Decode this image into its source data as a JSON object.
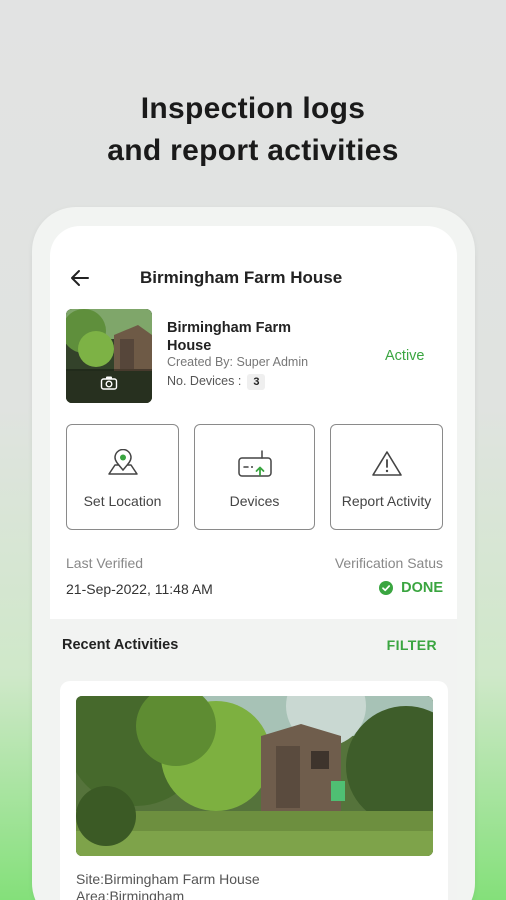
{
  "promo": {
    "headline_line1": "Inspection logs",
    "headline_line2": "and report activities"
  },
  "appbar": {
    "title": "Birmingham Farm House",
    "back_icon": "arrow-left-icon"
  },
  "property": {
    "name": "Birmingham Farm House",
    "created_by": "Created By: Super Admin",
    "devices_label": "No. Devices :",
    "devices_count": "3",
    "status": "Active",
    "thumbnail_icon": "camera-icon"
  },
  "actions": [
    {
      "label": "Set Location",
      "icon": "location-pin-icon"
    },
    {
      "label": "Devices",
      "icon": "router-device-icon"
    },
    {
      "label": "Report Activity",
      "icon": "warning-triangle-icon"
    }
  ],
  "verification": {
    "last_verified_label": "Last Verified",
    "last_verified_value": "21-Sep-2022, 11:48 AM",
    "status_label": "Verification Satus",
    "status_value": "DONE"
  },
  "recent": {
    "title": "Recent Activities",
    "filter_label": "FILTER",
    "items": [
      {
        "site": "Site:Birmingham Farm House",
        "area": "Area:Birmingham"
      }
    ]
  },
  "colors": {
    "accent_green": "#3aa540",
    "background_top": "#e2e3e3",
    "background_bottom": "#84e07a"
  }
}
